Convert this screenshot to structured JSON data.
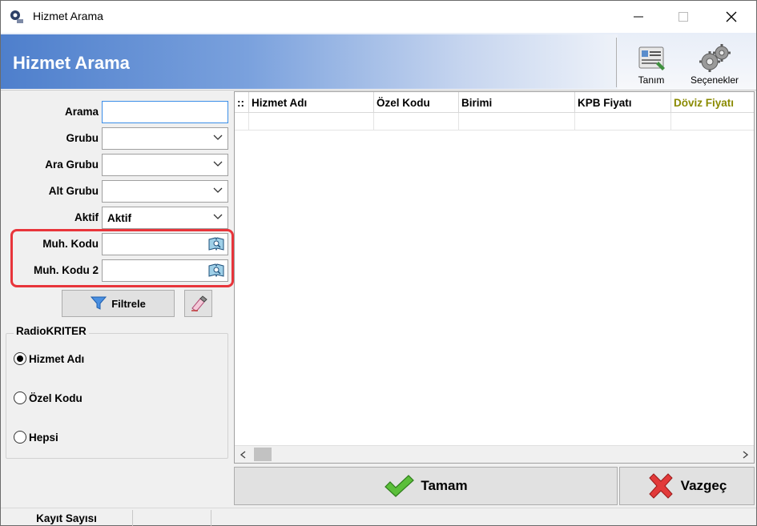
{
  "window": {
    "title": "Hizmet Arama"
  },
  "header": {
    "title": "Hizmet Arama"
  },
  "toolbar": {
    "tanim_label": "Tanım",
    "secenekler_label": "Seçenekler"
  },
  "filters": {
    "arama": {
      "label": "Arama",
      "value": ""
    },
    "grubu": {
      "label": "Grubu",
      "value": ""
    },
    "ara_grubu": {
      "label": "Ara Grubu",
      "value": ""
    },
    "alt_grubu": {
      "label": "Alt Grubu",
      "value": ""
    },
    "aktif": {
      "label": "Aktif",
      "value": "Aktif"
    },
    "muh_kodu": {
      "label": "Muh. Kodu",
      "value": ""
    },
    "muh_kodu_2": {
      "label": "Muh. Kodu 2",
      "value": ""
    },
    "filtrele_label": "Filtrele"
  },
  "radio_group": {
    "legend": "RadioKRITER",
    "options": [
      {
        "label": "Hizmet Adı",
        "checked": true
      },
      {
        "label": "Özel Kodu",
        "checked": false
      },
      {
        "label": "Hepsi",
        "checked": false
      }
    ]
  },
  "grid": {
    "row_indicator": "::",
    "columns": [
      "Hizmet Adı",
      "Özel Kodu",
      "Birimi",
      "KPB Fiyatı",
      "Döviz Fiyatı"
    ],
    "highlight_column_color": "#8a8a00"
  },
  "footer": {
    "tamam_label": "Tamam",
    "vazgec_label": "Vazgeç"
  },
  "status": {
    "kayit_sayisi_label": "Kayıt Sayısı",
    "kayit_sayisi_value": ""
  },
  "colors": {
    "header_gradient_start": "#4e7fcc",
    "highlight_border": "#e8353b",
    "focus_border": "#3c8ee8"
  }
}
